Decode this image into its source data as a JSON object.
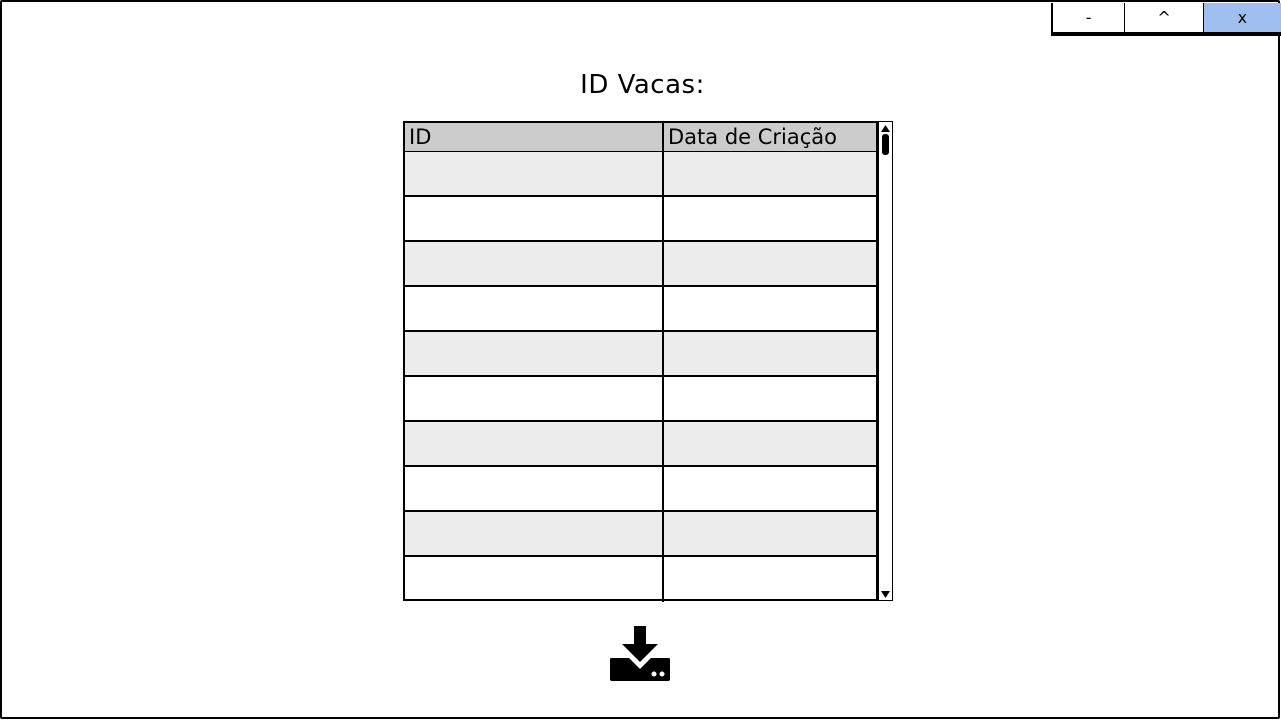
{
  "window": {
    "controls": {
      "minimize_label": "-",
      "maximize_label": "^",
      "close_label": "x"
    },
    "close_accent_color": "#9fbff0"
  },
  "page": {
    "title": "ID Vacas:"
  },
  "table": {
    "columns": [
      "ID",
      "Data de Criação"
    ],
    "header_color": "#cccccc",
    "stripe_color": "#ececec",
    "rows": [
      [
        "",
        ""
      ],
      [
        "",
        ""
      ],
      [
        "",
        ""
      ],
      [
        "",
        ""
      ],
      [
        "",
        ""
      ],
      [
        "",
        ""
      ],
      [
        "",
        ""
      ],
      [
        "",
        ""
      ],
      [
        "",
        ""
      ],
      [
        "",
        ""
      ]
    ]
  },
  "actions": {
    "download_icon": "download-icon"
  }
}
